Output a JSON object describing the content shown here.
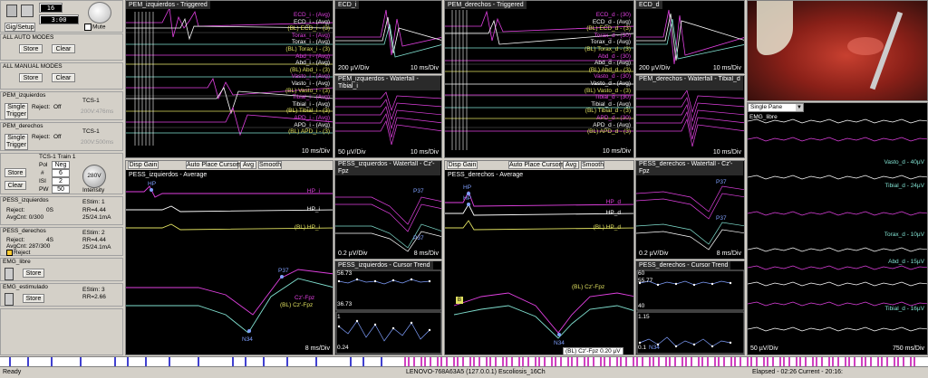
{
  "toolbar": {
    "counter1": "16",
    "counter2": "3:00",
    "gain_label": "Gig/Setup",
    "mute_label": "Mute"
  },
  "left_groups": [
    {
      "title": "ALL AUTO MODES",
      "store": "Store",
      "clear": "Clear"
    },
    {
      "title": "ALL MANUAL MODES",
      "store": "Store",
      "clear": "Clear"
    },
    {
      "title": "PEM_izquierdos",
      "trigger": "Single Trigger",
      "reject": "Reject:",
      "reject_val": "Off",
      "tcs": "TCS-1",
      "detail": "200V:476ms"
    },
    {
      "title": "PEM_derechos",
      "trigger": "Single Trigger",
      "reject": "Reject:",
      "reject_val": "Off",
      "tcs": "TCS-1",
      "detail": "200V:500ms"
    }
  ],
  "stim": {
    "title": "TCS-1 Train 1",
    "pol_label": "Pol",
    "pol_val": "Neg",
    "num_label": "#",
    "num_val": "6",
    "isi_label": "ISI",
    "isi_val": "2",
    "pw_label": "PW",
    "pw_val": "50",
    "intensity_knob": "280V",
    "intensity_label": "Intensity",
    "store": "Store",
    "clear": "Clear"
  },
  "pess": [
    {
      "title": "PESS_izquierdos",
      "estim": "EStim: 1",
      "reject": "Reject:",
      "reject_val": "0S",
      "avg": "AvgCnt: 0/300",
      "rr": "RR=4.44",
      "amp": "25/24.1mA"
    },
    {
      "title": "PESS_derechos",
      "estim": "EStim: 2",
      "reject": "Reject:",
      "reject_val": "4S",
      "avg": "AvgCnt: 287/300",
      "rr": "RR=4.44",
      "amp": "25/24.1mA",
      "reject_btn": "Reject"
    }
  ],
  "emg": [
    {
      "title": "EMG_libre",
      "store": "Store"
    },
    {
      "title": "EMG_estimulado",
      "estim": "EStim: 3",
      "rr": "RR=2.66",
      "store": "Store"
    }
  ],
  "panels": {
    "pem_izq_trig": {
      "title": "PEM_izquierdos - Triggered",
      "scale": "10 ms/Div",
      "labels": [
        "ECD_i - (Avg)",
        "ECD_i - (Avg)",
        "(BL) ECD_i - (3)",
        "Torax_i - (Avg)",
        "Torax_i - (Avg)",
        "(BL) Torax_i - (3)",
        "Abd_i - (Avg)",
        "Abd_i - (Avg)",
        "(BL) Abd_i - (3)",
        "Vasto_i - (Avg)",
        "Vasto_i - (Avg)",
        "(BL) Vasto_i - (3)",
        "Tibial_i - (Avg)",
        "Tibial_i - (Avg)",
        "(BL) Tibial_i - (3)",
        "APD_i - (Avg)",
        "APD_i - (Avg)",
        "(BL) APD_i - (3)"
      ]
    },
    "ecd_i": {
      "title": "ECD_i",
      "scale_v": "200 µV/Div",
      "scale_t": "10 ms/Div"
    },
    "pem_izq_water": {
      "title": "PEM_izquierdos - Waterfall - Tibial_i",
      "scale_v": "50 µV/Div",
      "scale_t": "10 ms/Div"
    },
    "pem_der_trig": {
      "title": "PEM_derechos - Triggered",
      "scale": "10 ms/Div",
      "labels": [
        "ECD_d - (30)",
        "ECD_d - (Avg)",
        "(BL) ECD_d - (3)",
        "Torax_d - (30)",
        "Torax_d - (Avg)",
        "(BL) Torax_d - (3)",
        "Abd_d - (30)",
        "Abd_d - (Avg)",
        "(BL) Abd_d - (3)",
        "Vasto_d - (30)",
        "Vasto_d - (Avg)",
        "(BL) Vasto_d - (3)",
        "Tibial_d - (30)",
        "Tibial_d - (Avg)",
        "(BL) Tibial_d - (3)",
        "APD_d - (30)",
        "APD_d - (Avg)",
        "(BL) APD_d - (3)"
      ]
    },
    "ecd_d": {
      "title": "ECD_d",
      "scale_v": "200 µV/Div",
      "scale_t": "10 ms/Div"
    },
    "pem_der_water": {
      "title": "PEM_derechos - Waterfall - Tibial_d",
      "scale_t": "10 ms/Div"
    },
    "emg": {
      "title": "EMG_libre",
      "pane_select": "Single Pane",
      "scale_v": "50 µV/Div",
      "scale_t": "750 ms/Div",
      "labels": [
        "Vasto_d - 40µV",
        "Tibial_d - 24µV",
        "Torax_d - 10µV",
        "Abd_d - 15µV",
        "Tibial_d - 16µV"
      ]
    },
    "pess_izq_avg": {
      "title": "PESS_izquierdos - Average",
      "disp_gain": "Disp Gain",
      "auto_place": "Auto Place Cursors",
      "avg_btn": "Avg",
      "smooth_btn": "Smooth",
      "scale": "8 ms/Div",
      "labels": [
        "HP",
        "HP_i",
        "HP_i",
        "(BL) HP_i",
        "P37",
        "(BL) Cz'-Fpz",
        "Cz'-Fpz",
        "N34"
      ]
    },
    "pess_izq_water": {
      "title": "PESS_izquierdos - Waterfall - Cz'-Fpz",
      "scale_v": "0.2 µV/Div",
      "scale_t": "8 ms/Div",
      "peak1": "P37",
      "peak2": "P37"
    },
    "pess_izq_trend": {
      "title": "PESS_izquierdos - Cursor Trend",
      "v1": "56.73",
      "v2": "36.73",
      "v3": "1",
      "v4": "0.24"
    },
    "pess_der_avg": {
      "title": "PESS_derechos - Average",
      "disp_gain": "Disp Gain",
      "auto_place": "Auto Place Cursors",
      "avg_btn": "Avg",
      "smooth_btn": "Smooth",
      "marker": "B",
      "labels": [
        "HP",
        "HP",
        "HP_d",
        "HP_d",
        "(BL) HP_d",
        "(BL) Cz'-Fpz",
        "N34",
        "(BL)",
        "(BL) Cz'-Fpz 0.20 µV"
      ]
    },
    "pess_der_water": {
      "title": "PESS_derechos - Waterfall - Cz'-Fpz",
      "scale_v": "0.2 µV/Div",
      "scale_t": "8 ms/Div",
      "peak1": "P37",
      "peak2": "P37"
    },
    "pess_der_trend": {
      "title": "PESS_derechos - Cursor Trend",
      "v1": "60",
      "v2": "55.77",
      "v3": "40",
      "v4": "1.15",
      "v5": "0.1",
      "v6": "N34"
    }
  },
  "status": {
    "ready": "Ready",
    "host": "LENOVO-768A63A5 (127.0.0.1) Escoliosis_16Ch",
    "elapsed": "Elapsed - 02:26 Current - 20:16:"
  },
  "colors": {
    "trace_magenta": "#e040e0",
    "trace_cyan": "#80e0d0",
    "trace_white": "#ffffff",
    "trace_yellow": "#e0e060",
    "bg": "#000000"
  }
}
